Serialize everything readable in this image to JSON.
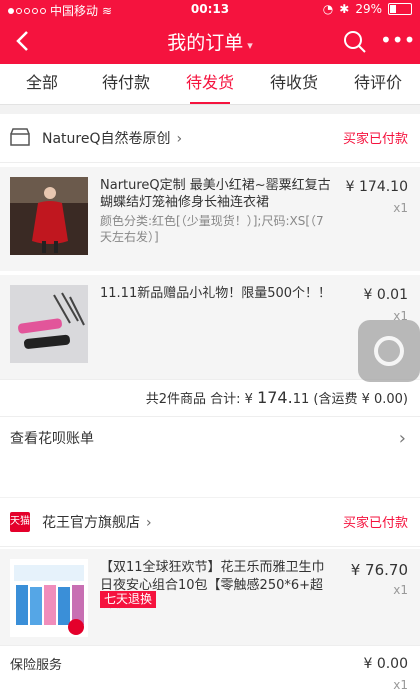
{
  "status_bar": {
    "carrier": "中国移动",
    "time": "00:13",
    "battery": "29%"
  },
  "nav": {
    "title": "我的订单",
    "caret": "▾"
  },
  "tabs": [
    {
      "label": "全部"
    },
    {
      "label": "待付款"
    },
    {
      "label": "待发货",
      "active": true
    },
    {
      "label": "待收货"
    },
    {
      "label": "待评价"
    }
  ],
  "orders": [
    {
      "shop": "NatureQ自然卷原创",
      "status": "买家已付款",
      "items": [
        {
          "name": "NartureQ定制 最美小红裙~罂粟红复古蝴蝶结灯笼袖修身长袖连衣裙",
          "sku": "颜色分类:红色[（少量现货！）];尺码:XS[（7天左右发）]",
          "price": "¥ 174.10",
          "qty": "x1"
        },
        {
          "name": "11.11新品赠品小礼物！限量500个！！",
          "sku": "",
          "price": "¥ 0.01",
          "qty": "x1"
        }
      ],
      "summary": {
        "prefix": "共2件商品  合计: ¥ ",
        "total_big": "174.",
        "total_small": "11",
        "shipping": " (含运费 ¥ 0.00)"
      },
      "link": "查看花呗账单"
    },
    {
      "shop": "花王官方旗舰店",
      "shop_logo": "天猫",
      "status": "买家已付款",
      "items": [
        {
          "name": "【双11全球狂欢节】花王乐而雅卫生巾日夜安心组合10包【零触感250*6+超瞬吸…",
          "badge": "七天退换",
          "price": "¥ 76.70",
          "qty": "x1"
        }
      ]
    }
  ],
  "service": {
    "label": "保险服务",
    "price": "¥ 0.00",
    "qty": "x1"
  },
  "colors": {
    "brand": "#f5133e"
  },
  "icons": [
    "back-arrow-icon",
    "search-icon",
    "more-icon",
    "shop-icon",
    "chevron-right-icon",
    "assistive-touch-icon"
  ]
}
